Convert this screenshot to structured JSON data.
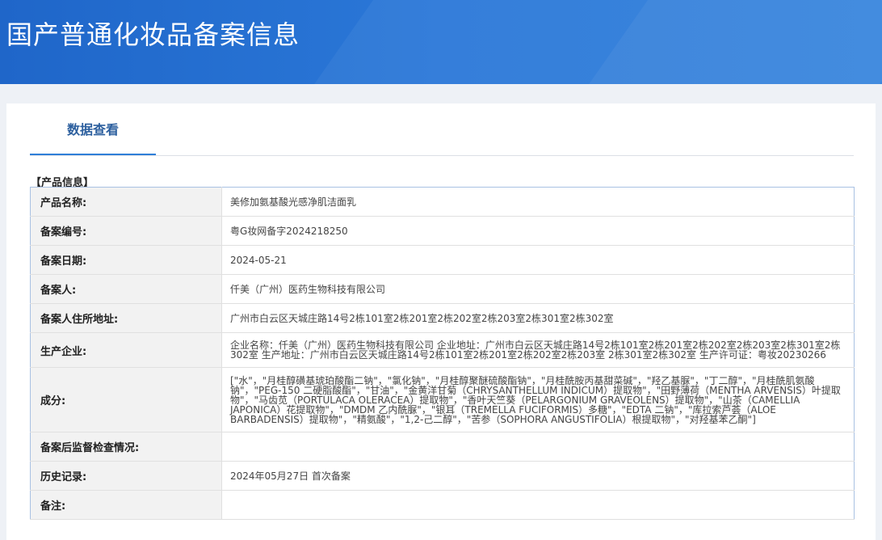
{
  "header": {
    "title": "国产普通化妆品备案信息"
  },
  "tabs": [
    {
      "label": "数据查看",
      "active": true
    }
  ],
  "section": {
    "title": "【产品信息】"
  },
  "rows": [
    {
      "label": "产品名称:",
      "value": "美修加氨基酸光感净肌洁面乳"
    },
    {
      "label": "备案编号:",
      "value": "粤G妆网备字2024218250"
    },
    {
      "label": "备案日期:",
      "value": "2024-05-21"
    },
    {
      "label": "备案人:",
      "value": "仟美（广州）医药生物科技有限公司"
    },
    {
      "label": "备案人住所地址:",
      "value": "广州市白云区天城庄路14号2栋101室2栋201室2栋202室2栋203室2栋301室2栋302室"
    },
    {
      "label": "生产企业:",
      "value": "企业名称：仟美（广州）医药生物科技有限公司 企业地址：广州市白云区天城庄路14号2栋101室2栋201室2栋202室2栋203室2栋301室2栋302室 生产地址：广州市白云区天城庄路14号2栋101室2栋201室2栋202室2栋203室 2栋301室2栋302室 生产许可证：粤妆20230266"
    },
    {
      "label": "成分:",
      "value": "[\"水\"，\"月桂醇磺基琥珀酸酯二钠\"，\"氯化钠\"，\"月桂醇聚醚硫酸酯钠\"，\"月桂酰胺丙基甜菜碱\"，\"羟乙基脲\"，\"丁二醇\"，\"月桂酰肌氨酸钠\"，\"PEG-150 二硬脂酸酯\"，\"甘油\"，\"金黄洋甘菊（CHRYSANTHELLUM INDICUM）提取物\"，\"田野薄荷（MENTHA ARVENSIS）叶提取物\"，\"马齿苋（PORTULACA OLERACEA）提取物\"，\"香叶天竺葵（PELARGONIUM GRAVEOLENS）提取物\"，\"山茶（CAMELLIA JAPONICA）花提取物\"，\"DMDM 乙内酰脲\"，\"银耳（TREMELLA FUCIFORMIS）多糖\"，\"EDTA 二钠\"，\"库拉索芦荟（ALOE BARBADENSIS）提取物\"，\"精氨酸\"，\"1,2-己二醇\"，\"苦参（SOPHORA ANGUSTIFOLIA）根提取物\"，\"对羟基苯乙酮\"]"
    },
    {
      "label": "备案后监督检查情况:",
      "value": ""
    },
    {
      "label": "历史记录:",
      "value": "2024年05月27日 首次备案"
    },
    {
      "label": "备注:",
      "value": ""
    }
  ]
}
